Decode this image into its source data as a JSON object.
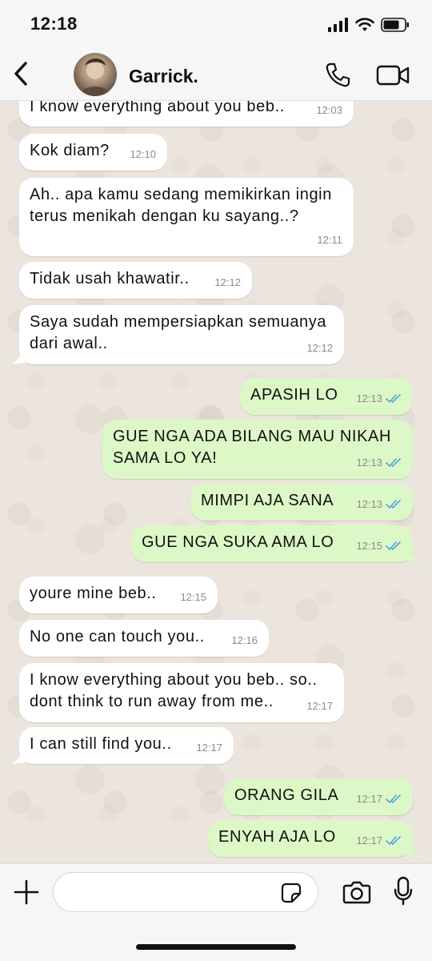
{
  "status_bar": {
    "time": "12:18"
  },
  "header": {
    "contact_name": "Garrick.",
    "back_icon": "chevron-left-icon",
    "call_icon": "phone-icon",
    "video_icon": "video-camera-icon"
  },
  "messages": [
    {
      "direction": "in",
      "text": "I know everything about you beb..",
      "time": "12:03"
    },
    {
      "direction": "in",
      "text": "Kok diam?",
      "time": "12:10"
    },
    {
      "direction": "in",
      "text": "Ah.. apa kamu sedang memikirkan ingin\nterus menikah dengan ku sayang..?",
      "time": "12:11"
    },
    {
      "direction": "in",
      "text": "Tidak usah khawatir..",
      "time": "12:12"
    },
    {
      "direction": "in",
      "text": "Saya sudah mempersiapkan semuanya\ndari awal..",
      "time": "12:12"
    },
    {
      "direction": "out",
      "text": "APASIH LO",
      "time": "12:13"
    },
    {
      "direction": "out",
      "text": "GUE NGA ADA BILANG MAU NIKAH\nSAMA LO YA!",
      "time": "12:13"
    },
    {
      "direction": "out",
      "text": "MIMPI AJA SANA",
      "time": "12:13"
    },
    {
      "direction": "out",
      "text": "GUE NGA SUKA AMA LO",
      "time": "12:15"
    },
    {
      "direction": "in",
      "text": "youre mine beb..",
      "time": "12:15"
    },
    {
      "direction": "in",
      "text": "No one can touch you..",
      "time": "12:16"
    },
    {
      "direction": "in",
      "text": "I know everything about you beb.. so..\ndont think to run away from me..",
      "time": "12:17"
    },
    {
      "direction": "in",
      "text": "I can still find you..",
      "time": "12:17"
    },
    {
      "direction": "out",
      "text": "ORANG GILA",
      "time": "12:17"
    },
    {
      "direction": "out",
      "text": "ENYAH AJA LO",
      "time": "12:17"
    }
  ],
  "input_bar": {
    "placeholder": "",
    "value": ""
  },
  "colors": {
    "incoming_bubble": "#ffffff",
    "outgoing_bubble": "#dcf8c6",
    "read_ticks": "#4fa3e0",
    "chat_background": "#ece5dd"
  }
}
